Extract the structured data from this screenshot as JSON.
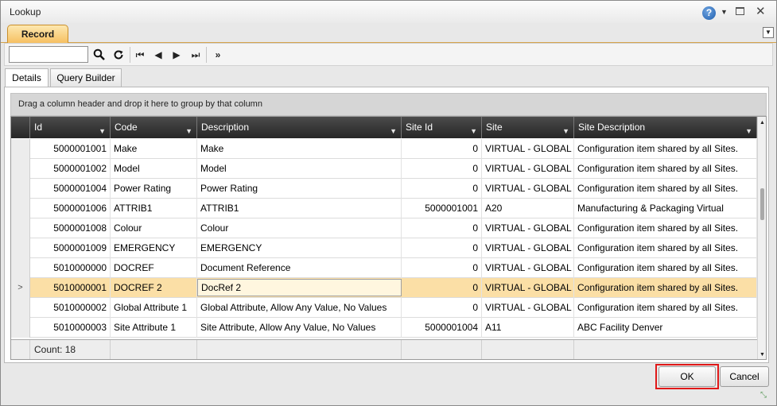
{
  "window": {
    "title": "Lookup"
  },
  "tabs": {
    "record": "Record"
  },
  "subtabs": [
    "Details",
    "Query Builder"
  ],
  "search": {
    "value": "",
    "placeholder": ""
  },
  "grid": {
    "group_hint": "Drag a column header and drop it here to group by that column",
    "columns": [
      "Id",
      "Code",
      "Description",
      "Site Id",
      "Site",
      "Site Description"
    ],
    "rows": [
      {
        "id": "5000001001",
        "code": "Make",
        "description": "Make",
        "site_id": "0",
        "site": "VIRTUAL - GLOBAL",
        "site_description": "Configuration item shared by all Sites."
      },
      {
        "id": "5000001002",
        "code": "Model",
        "description": "Model",
        "site_id": "0",
        "site": "VIRTUAL - GLOBAL",
        "site_description": "Configuration item shared by all Sites."
      },
      {
        "id": "5000001004",
        "code": "Power Rating",
        "description": "Power Rating",
        "site_id": "0",
        "site": "VIRTUAL - GLOBAL",
        "site_description": "Configuration item shared by all Sites."
      },
      {
        "id": "5000001006",
        "code": "ATTRIB1",
        "description": "ATTRIB1",
        "site_id": "5000001001",
        "site": "A20",
        "site_description": "Manufacturing & Packaging Virtual"
      },
      {
        "id": "5000001008",
        "code": "Colour",
        "description": "Colour",
        "site_id": "0",
        "site": "VIRTUAL - GLOBAL",
        "site_description": "Configuration item shared by all Sites."
      },
      {
        "id": "5000001009",
        "code": "EMERGENCY",
        "description": "EMERGENCY",
        "site_id": "0",
        "site": "VIRTUAL - GLOBAL",
        "site_description": "Configuration item shared by all Sites."
      },
      {
        "id": "5010000000",
        "code": "DOCREF",
        "description": "Document Reference",
        "site_id": "0",
        "site": "VIRTUAL - GLOBAL",
        "site_description": "Configuration item shared by all Sites."
      },
      {
        "id": "5010000001",
        "code": "DOCREF 2",
        "description": "DocRef 2",
        "site_id": "0",
        "site": "VIRTUAL - GLOBAL",
        "site_description": "Configuration item shared by all Sites."
      },
      {
        "id": "5010000002",
        "code": "Global Attribute 1",
        "description": "Global Attribute, Allow Any Value, No Values",
        "site_id": "0",
        "site": "VIRTUAL - GLOBAL",
        "site_description": "Configuration item shared by all Sites."
      },
      {
        "id": "5010000003",
        "code": "Site Attribute 1",
        "description": "Site Attribute, Allow Any Value, No Values",
        "site_id": "5000001004",
        "site": "A11",
        "site_description": "ABC Facility Denver"
      }
    ],
    "selected_row_index": 7,
    "count_label": "Count: 18"
  },
  "buttons": {
    "ok": "OK",
    "cancel": "Cancel"
  },
  "icons": {
    "help": "help-icon",
    "search": "search-icon",
    "refresh": "refresh-icon",
    "first": "first-page-icon",
    "prev": "prev-icon",
    "next": "next-icon",
    "last": "last-page-icon",
    "more": "double-chevron-icon",
    "filter": "filter-icon",
    "row_pointer": "row-pointer-icon"
  },
  "colors": {
    "accent_tab": "#f6c062",
    "selected_row": "#fbdfa6",
    "highlight": "#e01818"
  }
}
